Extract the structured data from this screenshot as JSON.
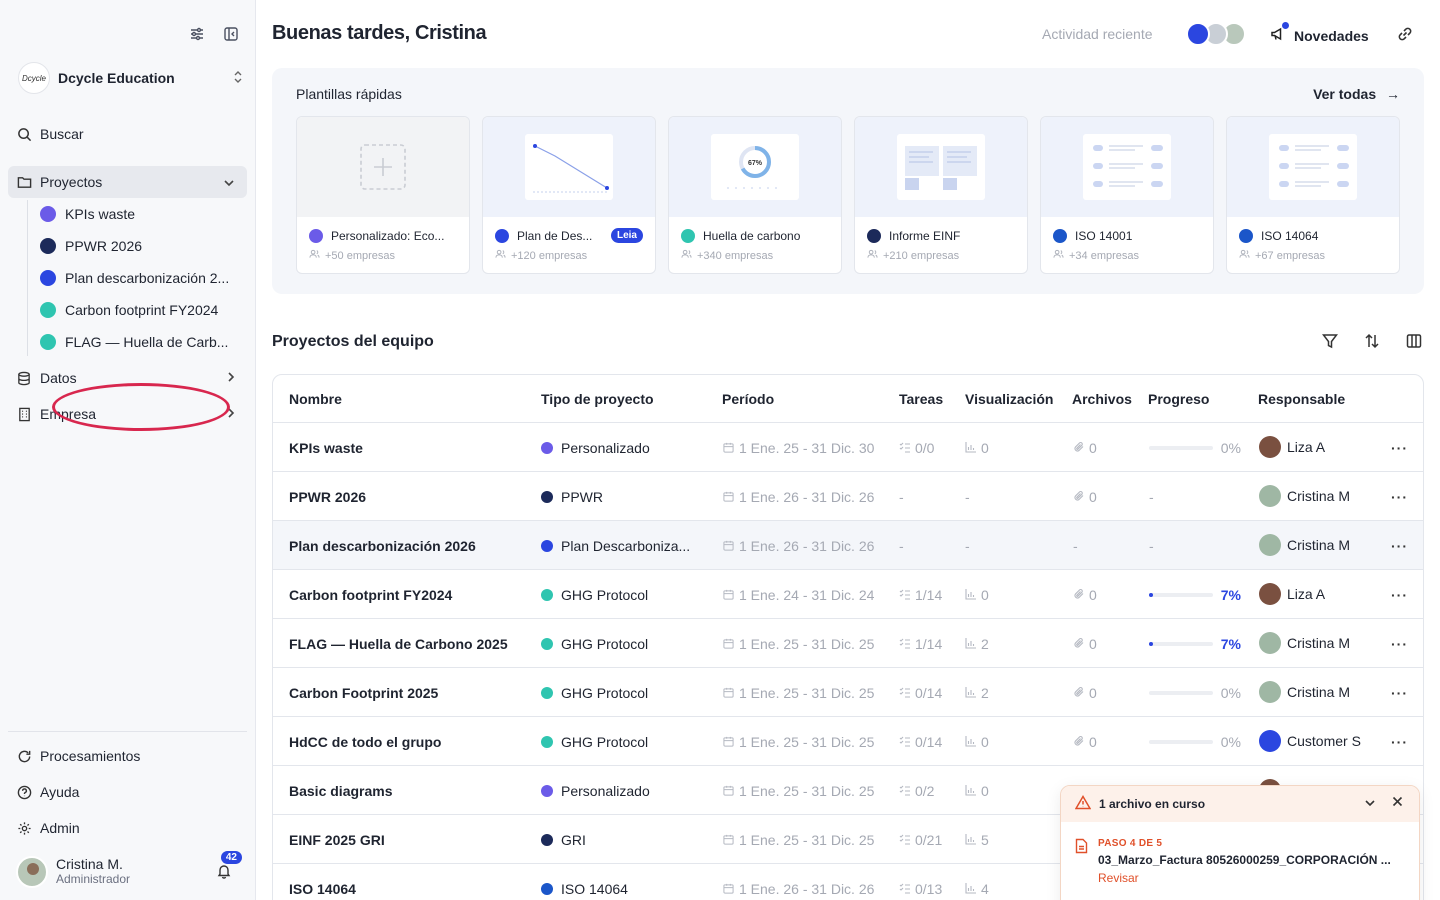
{
  "sidebar": {
    "org_name": "Dcycle Education",
    "org_logo_text": "Dcycle",
    "search_label": "Buscar",
    "projects_label": "Proyectos",
    "project_items": [
      {
        "label": "KPIs waste",
        "color": "#6b5be8"
      },
      {
        "label": "PPWR 2026",
        "color": "#1c2a5a"
      },
      {
        "label": "Plan descarbonización 2...",
        "color": "#2b46e0"
      },
      {
        "label": "Carbon footprint FY2024",
        "color": "#2fc5b0"
      },
      {
        "label": "FLAG — Huella de Carb...",
        "color": "#2fc5b0"
      }
    ],
    "datos_label": "Datos",
    "empresa_label": "Empresa",
    "processing_label": "Procesamientos",
    "help_label": "Ayuda",
    "admin_label": "Admin",
    "user_name": "Cristina M.",
    "user_role": "Administrador",
    "notif_count": "42"
  },
  "header": {
    "greeting": "Buenas tardes, Cristina",
    "recent_activity": "Actividad reciente",
    "news_label": "Novedades"
  },
  "templates": {
    "title": "Plantillas rápidas",
    "see_all": "Ver todas",
    "items": [
      {
        "name": "Personalizado: Eco...",
        "count": "+50 empresas",
        "color": "#6b5be8"
      },
      {
        "name": "Plan de Des...",
        "count": "+120 empresas",
        "color": "#2b46e0",
        "badge": "Leia"
      },
      {
        "name": "Huella de carbono",
        "count": "+340 empresas",
        "color": "#2fc5b0",
        "ring_pct": "67%"
      },
      {
        "name": "Informe EINF",
        "count": "+210 empresas",
        "color": "#1c2a5a"
      },
      {
        "name": "ISO 14001",
        "count": "+34 empresas",
        "color": "#1b56c9"
      },
      {
        "name": "ISO 14064",
        "count": "+67 empresas",
        "color": "#1b56c9"
      }
    ]
  },
  "projects": {
    "title": "Proyectos del equipo",
    "columns": [
      "Nombre",
      "Tipo de proyecto",
      "Período",
      "Tareas",
      "Visualización",
      "Archivos",
      "Progreso",
      "Responsable"
    ],
    "rows": [
      {
        "name": "KPIs waste",
        "type": "Personalizado",
        "type_color": "#6b5be8",
        "period": "1 Ene. 25 - 31 Dic. 30",
        "tasks": "0/0",
        "vis": "0",
        "files": "0",
        "progress": 0,
        "progress_label": "0%",
        "owner": "Liza A",
        "owner_color": "#7a5040"
      },
      {
        "name": "PPWR 2026",
        "type": "PPWR",
        "type_color": "#1c2a5a",
        "period": "1 Ene. 26 - 31 Dic. 26",
        "tasks": "-",
        "vis": "-",
        "files": "0",
        "progress": null,
        "progress_label": "-",
        "owner": "Cristina M",
        "owner_color": "#9fb7a4"
      },
      {
        "name": "Plan descarbonización 2026",
        "type": "Plan Descarboniza...",
        "type_color": "#2b46e0",
        "period": "1 Ene. 26 - 31 Dic. 26",
        "tasks": "-",
        "vis": "-",
        "files": "-",
        "progress": null,
        "progress_label": "-",
        "owner": "Cristina M",
        "owner_color": "#9fb7a4"
      },
      {
        "name": "Carbon footprint FY2024",
        "type": "GHG Protocol",
        "type_color": "#2fc5b0",
        "period": "1 Ene. 24 - 31 Dic. 24",
        "tasks": "1/14",
        "vis": "0",
        "files": "0",
        "progress": 0.07,
        "progress_label": "7%",
        "owner": "Liza A",
        "owner_color": "#7a5040"
      },
      {
        "name": "FLAG — Huella de Carbono 2025",
        "type": "GHG Protocol",
        "type_color": "#2fc5b0",
        "period": "1 Ene. 25 - 31 Dic. 25",
        "tasks": "1/14",
        "vis": "2",
        "files": "0",
        "progress": 0.07,
        "progress_label": "7%",
        "owner": "Cristina M",
        "owner_color": "#9fb7a4"
      },
      {
        "name": "Carbon Footprint 2025",
        "type": "GHG Protocol",
        "type_color": "#2fc5b0",
        "period": "1 Ene. 25 - 31 Dic. 25",
        "tasks": "0/14",
        "vis": "2",
        "files": "0",
        "progress": 0,
        "progress_label": "0%",
        "owner": "Cristina M",
        "owner_color": "#9fb7a4"
      },
      {
        "name": "HdCC de todo el grupo",
        "type": "GHG Protocol",
        "type_color": "#2fc5b0",
        "period": "1 Ene. 25 - 31 Dic. 25",
        "tasks": "0/14",
        "vis": "0",
        "files": "0",
        "progress": 0,
        "progress_label": "0%",
        "owner": "Customer S",
        "owner_color": "#2b46e0"
      },
      {
        "name": "Basic diagrams",
        "type": "Personalizado",
        "type_color": "#6b5be8",
        "period": "1 Ene. 25 - 31 Dic. 25",
        "tasks": "0/2",
        "vis": "0",
        "files": "",
        "progress": null,
        "progress_label": "",
        "owner": "",
        "owner_color": "#7a5040"
      },
      {
        "name": "EINF 2025 GRI",
        "type": "GRI",
        "type_color": "#1c2a5a",
        "period": "1 Ene. 25 - 31 Dic. 25",
        "tasks": "0/21",
        "vis": "5",
        "files": "",
        "progress": null,
        "progress_label": "",
        "owner": "",
        "owner_color": ""
      },
      {
        "name": "ISO 14064",
        "type": "ISO 14064",
        "type_color": "#1b56c9",
        "period": "1 Ene. 26 - 31 Dic. 26",
        "tasks": "0/13",
        "vis": "4",
        "files": "",
        "progress": null,
        "progress_label": "",
        "owner": "",
        "owner_color": ""
      }
    ]
  },
  "upload_toast": {
    "title": "1 archivo en curso",
    "step": "PASO 4 DE 5",
    "file_name": "03_Marzo_Factura 80526000259_CORPORACIÓN ...",
    "action": "Revisar"
  },
  "colors": {
    "accent": "#2b46e0",
    "warning": "#e0502a",
    "annotation": "#d8274e"
  }
}
